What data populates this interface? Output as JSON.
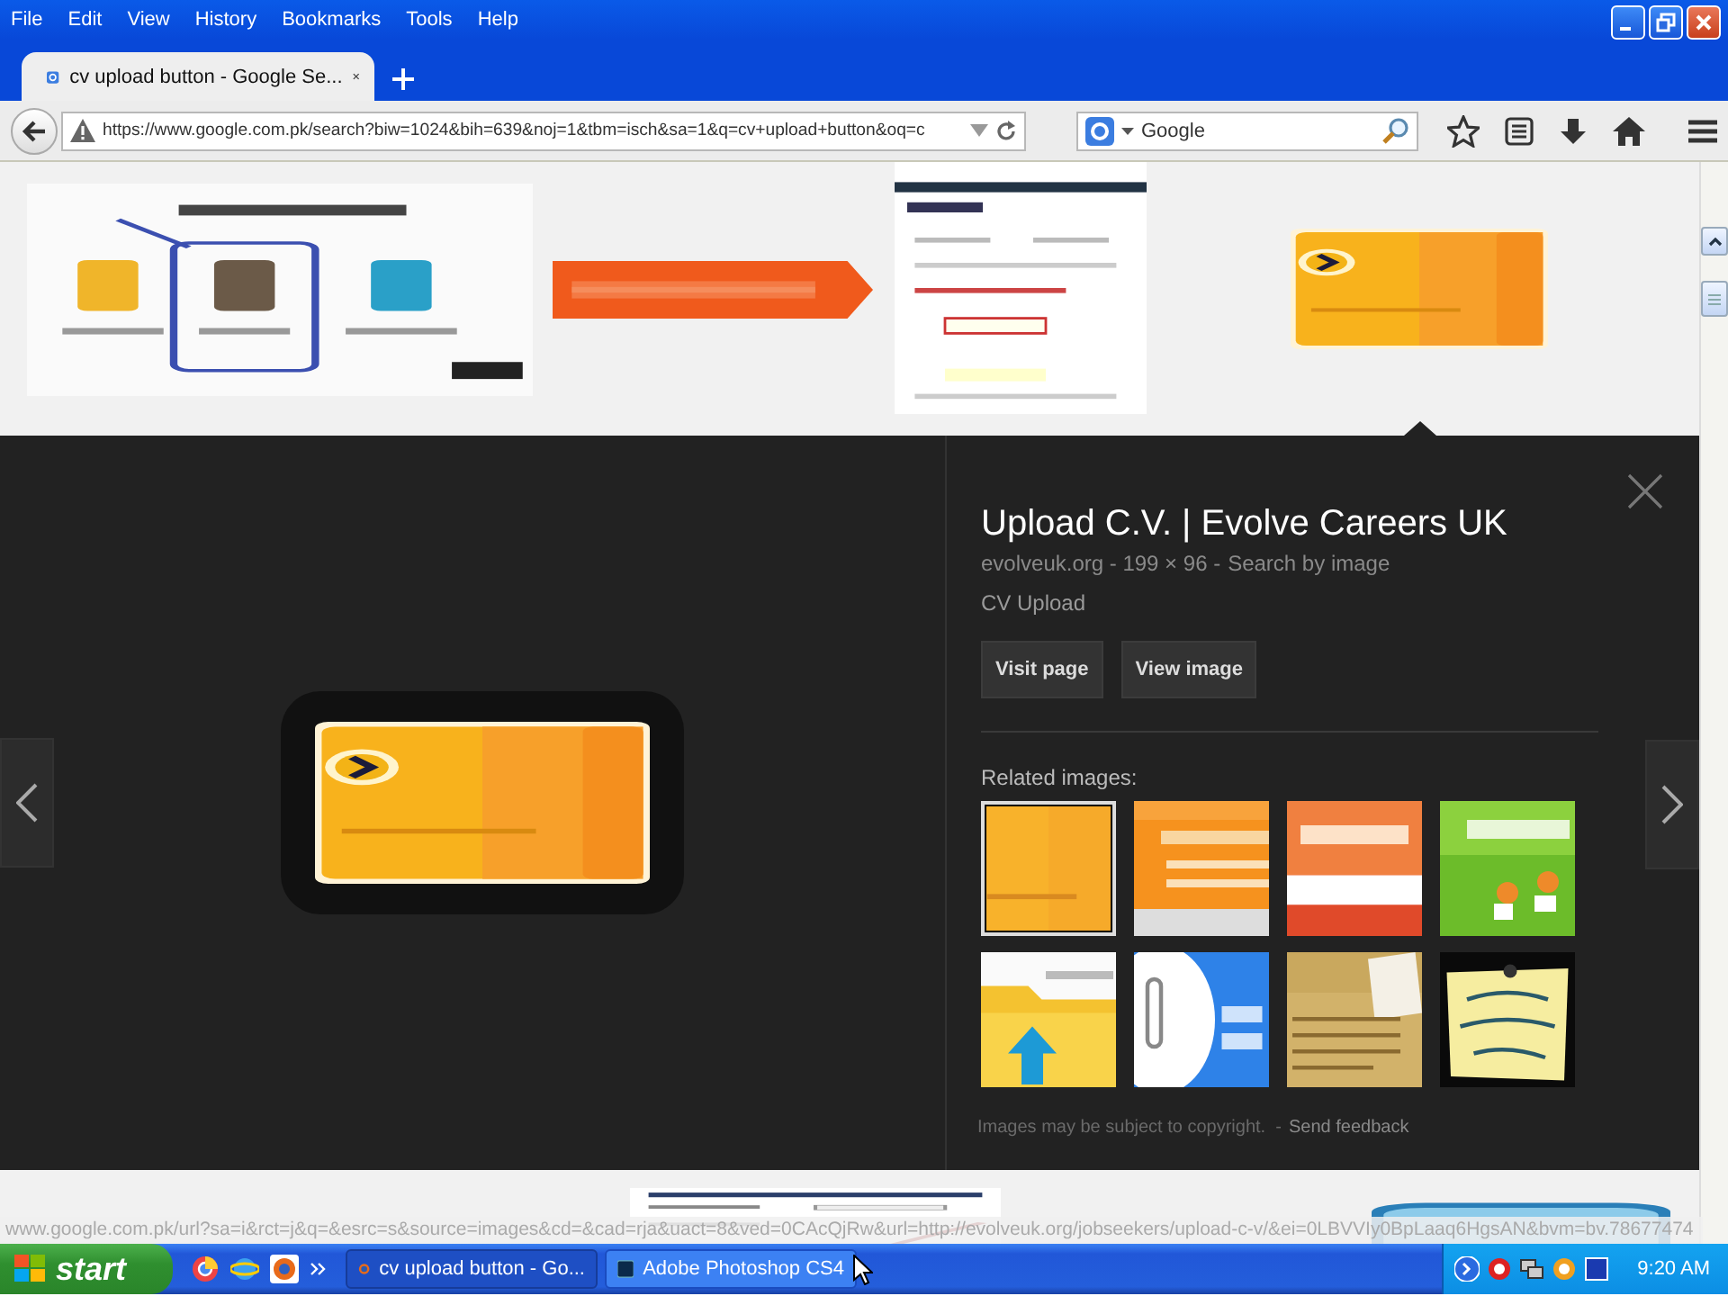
{
  "menu": [
    "File",
    "Edit",
    "View",
    "History",
    "Bookmarks",
    "Tools",
    "Help"
  ],
  "tabs": [
    {
      "label": "cv upload button - Google Se...",
      "selected": true
    }
  ],
  "address_bar": {
    "url": "https://www.google.com.pk/search?biw=1024&bih=639&noj=1&tbm=isch&sa=1&q=cv+upload+button&oq=c"
  },
  "search_box": {
    "placeholder": "Google"
  },
  "results": [
    {
      "kind": "picture",
      "selected": false
    },
    {
      "kind": "picture",
      "selected": false
    },
    {
      "kind": "picture",
      "selected": false
    },
    {
      "kind": "picture",
      "selected": true
    }
  ],
  "detail": {
    "title": "Upload C.V. | Evolve Careers UK",
    "meta": "evolveuk.org - 199 × 96 -",
    "search_link": "Search by image",
    "caption": "CV Upload",
    "buttons": [
      "Visit page",
      "View image"
    ],
    "related_label": "Related images:",
    "related": [
      {
        "kind": "picture",
        "selected": true
      },
      {
        "kind": "picture",
        "selected": false
      },
      {
        "kind": "picture",
        "selected": false
      },
      {
        "kind": "picture",
        "selected": false
      },
      {
        "kind": "picture",
        "selected": false
      },
      {
        "kind": "picture",
        "selected": false
      },
      {
        "kind": "picture",
        "selected": false
      },
      {
        "kind": "picture",
        "selected": false
      }
    ],
    "copyright": "Images may be subject to copyright.  -",
    "feedback": "Send feedback"
  },
  "more_results": [
    {
      "kind": "picture"
    },
    {
      "kind": "picture"
    }
  ],
  "status_url": "www.google.com.pk/url?sa=i&rct=j&q=&esrc=s&source=images&cd=&cad=rja&uact=8&ved=0CAcQjRw&url=http://evolveuk.org/jobseekers/upload-c-v/&ei=0LBVVIy0BpLaaq6HgsAN&bvm=bv.78677474",
  "taskbar": {
    "start": "start",
    "items": [
      {
        "label": "cv upload button - Go...",
        "selected": true
      },
      {
        "label": "Adobe Photoshop CS4",
        "selected": false
      }
    ],
    "clock": "9:20 AM"
  }
}
